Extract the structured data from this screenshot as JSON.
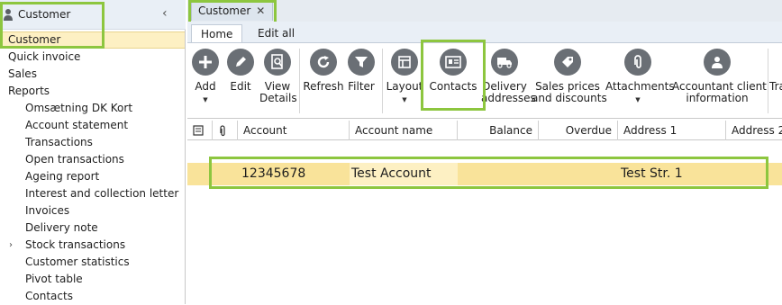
{
  "nav": {
    "header_title": "Customer",
    "collapse_glyph": "‹",
    "items": [
      {
        "label": "Customer",
        "level": 0,
        "selected": true
      },
      {
        "label": "Quick invoice",
        "level": 0
      },
      {
        "label": "Sales",
        "level": 0
      },
      {
        "label": "Reports",
        "level": 0
      },
      {
        "label": "Omsætning DK Kort",
        "level": 1
      },
      {
        "label": "Account statement",
        "level": 1
      },
      {
        "label": "Transactions",
        "level": 1
      },
      {
        "label": "Open transactions",
        "level": 1
      },
      {
        "label": "Ageing report",
        "level": 1
      },
      {
        "label": "Interest and collection letter",
        "level": 1
      },
      {
        "label": "Invoices",
        "level": 1
      },
      {
        "label": "Delivery note",
        "level": 1
      },
      {
        "label": "Stock transactions",
        "level": 1,
        "expandable": true
      },
      {
        "label": "Customer statistics",
        "level": 1
      },
      {
        "label": "Pivot table",
        "level": 1
      },
      {
        "label": "Contacts",
        "level": 1
      }
    ]
  },
  "doc_tab": {
    "label": "Customer",
    "close_glyph": "✕"
  },
  "ribbon": {
    "tabs": [
      {
        "label": "Home",
        "active": true
      },
      {
        "label": "Edit all"
      }
    ],
    "buttons": {
      "add": {
        "line1": "Add",
        "icon": "plus-icon",
        "dropdown": "▼"
      },
      "edit": {
        "line1": "Edit",
        "icon": "pencil-icon"
      },
      "view_details": {
        "line1": "View",
        "line2": "Details",
        "icon": "magnifier-document-icon"
      },
      "refresh": {
        "line1": "Refresh",
        "icon": "refresh-icon"
      },
      "filter": {
        "line1": "Filter",
        "icon": "funnel-icon"
      },
      "layout": {
        "line1": "Layout",
        "icon": "layout-icon",
        "dropdown": "▼"
      },
      "contacts": {
        "line1": "Contacts",
        "icon": "contact-card-icon"
      },
      "delivery": {
        "line1": "Delivery",
        "line2": "addresses",
        "icon": "delivery-truck-icon"
      },
      "sales_prices": {
        "line1": "Sales prices",
        "line2": "and discounts",
        "icon": "price-tag-icon"
      },
      "attachments": {
        "line1": "Attachments",
        "icon": "paperclip-icon",
        "dropdown": "▼"
      },
      "accountant": {
        "line1": "Accountant client",
        "line2": "information",
        "icon": "accountant-icon"
      },
      "cut_off": {
        "line1": "Tra"
      }
    }
  },
  "grid": {
    "headers": {
      "notes_icon": "note-icon",
      "attach_icon": "paperclip-icon",
      "account": "Account",
      "account_name": "Account name",
      "balance": "Balance",
      "overdue": "Overdue",
      "address1": "Address 1",
      "address2": "Address 2"
    },
    "rows": [
      {
        "account": "12345678",
        "account_name": "Test Account",
        "address1": "Test Str. 1"
      }
    ]
  },
  "colors": {
    "highlight_box": "#8dc63f",
    "selected_row": "#f9e39a",
    "icon_circle": "#6a6f75"
  }
}
